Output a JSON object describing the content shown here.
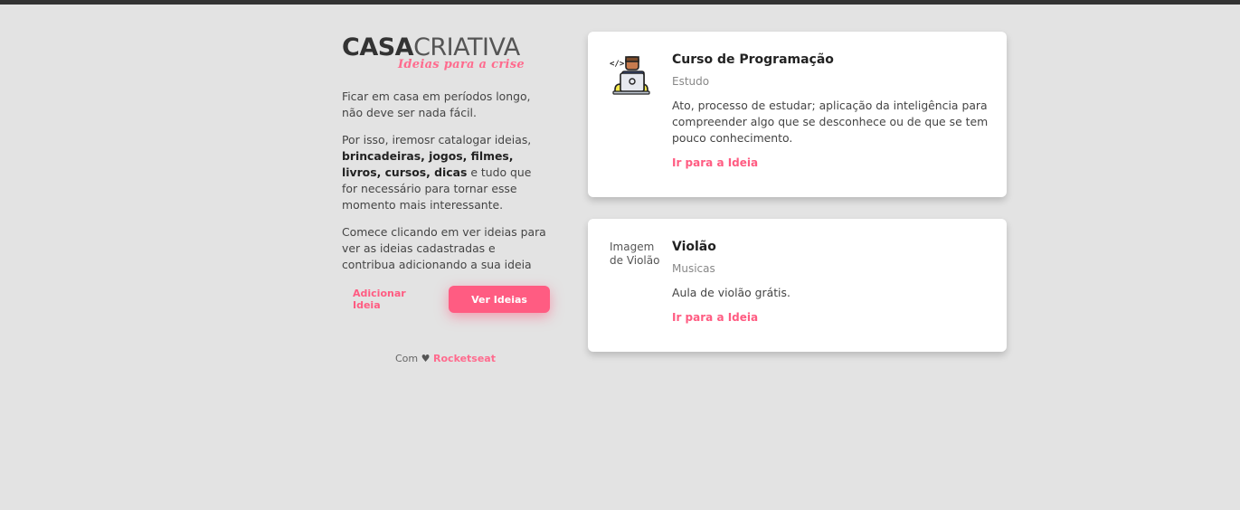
{
  "logo": {
    "bold": "CASA",
    "light": "CRIATIVA",
    "tagline": "Ideias para a crise"
  },
  "intro": {
    "p1": "Ficar em casa em períodos longo, não deve ser nada fácil.",
    "p2_start": "Por isso, iremosr catalogar ideias,",
    "p2_bold": "brincadeiras, jogos, filmes, livros, cursos, dicas",
    "p2_end": "e tudo que for necessário para tornar esse momento mais interessante.",
    "p3": "Comece clicando em ver ideias para ver as ideias cadastradas e contribua adicionando a sua ideia"
  },
  "actions": {
    "add_label": "Adicionar Ideia",
    "view_label": "Ver Ideias"
  },
  "footer": {
    "prefix": "Com",
    "heart": "♥",
    "brand": "Rocketseat"
  },
  "ideas": [
    {
      "title": "Curso de Programação",
      "category": "Estudo",
      "description": "Ato, processo de estudar; aplicação da inteligência para compreender algo que se desconhece ou de que se tem pouco conhecimento.",
      "link_label": "Ir para a Ideia",
      "icon": "programmer-icon"
    },
    {
      "title": "Violão",
      "category": "Musicas",
      "description": "Aula de violão grátis.",
      "link_label": "Ir para a Ideia",
      "image_alt": "Imagem de Violão"
    }
  ],
  "colors": {
    "accent": "#ff5c82",
    "background": "#e3e3e3",
    "topbar": "#333333"
  }
}
